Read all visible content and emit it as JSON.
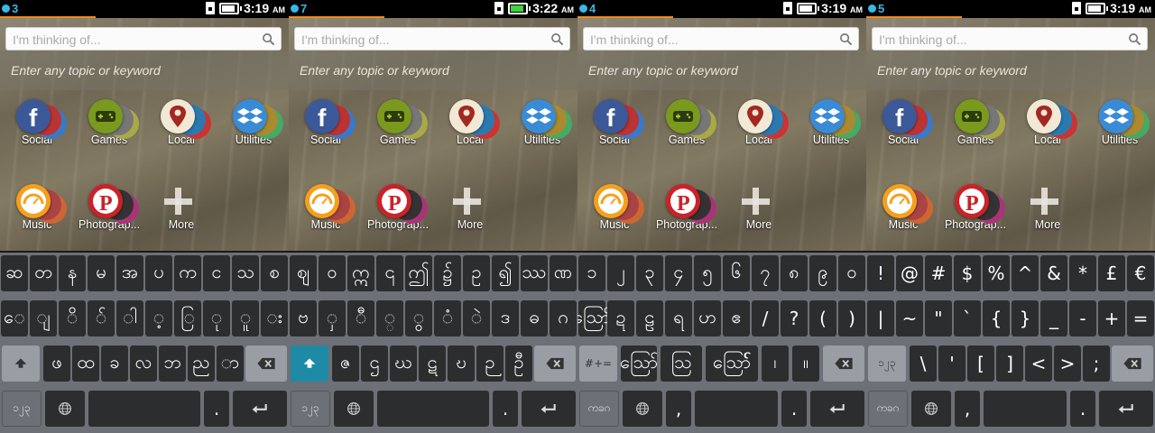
{
  "colors": {
    "accent_orange": "#f08a1e",
    "notif_blue": "#3ab7e8",
    "key_dark": "#2c2d2f",
    "key_fn": "#9a9ea4",
    "shift_active": "#1e8aa6",
    "keyboard_bg": "#6d7076",
    "battery_green": "#3fd13f"
  },
  "screens": [
    {
      "notif_count": "3",
      "progress_fraction": 0.33,
      "time": "3:19",
      "ampm": "AM",
      "charging": false,
      "search": {
        "placeholder": "I'm thinking of...",
        "hint": "Enter any topic or keyword"
      },
      "tiles": [
        "Social",
        "Games",
        "Local",
        "Utilities",
        "Music",
        "Photograp...",
        "More"
      ],
      "keys": {
        "row1": [
          "ဆ",
          "တ",
          "န",
          "မ",
          "အ",
          "ပ",
          "က",
          "င",
          "သ",
          "စ"
        ],
        "row2": [
          "ေ",
          "ျ",
          "ိ",
          "်",
          "ါ",
          "့",
          "ြ",
          "ု",
          "ူ",
          "း"
        ],
        "row3": [
          "shift-icon",
          "ဖ",
          "ထ",
          "ခ",
          "လ",
          "ဘ",
          "ည",
          "ာ",
          "backspace-icon"
        ],
        "row4": [
          "၁၂၃",
          "globe-icon",
          "space",
          ".",
          "enter-icon"
        ]
      },
      "shift_active": false
    },
    {
      "notif_count": "7",
      "progress_fraction": 0.33,
      "time": "3:22",
      "ampm": "AM",
      "charging": true,
      "search": {
        "placeholder": "I'm thinking of...",
        "hint": "Enter any topic or keyword"
      },
      "tiles": [
        "Social",
        "Games",
        "Local",
        "Utilities",
        "Music",
        "Photograp...",
        "More"
      ],
      "keys": {
        "row1": [
          "ဈ",
          "ဝ",
          "ဣ",
          "၎",
          "ဤ",
          "၌",
          "ဥ",
          "၍",
          "ဿ",
          "ဏ"
        ],
        "row2": [
          "ဗ",
          "ှ",
          "ီ",
          "္",
          "ွ",
          "ံ",
          "ဲ",
          "ဒ",
          "ဓ",
          "ဂ"
        ],
        "row3": [
          "shift-icon",
          "ဇ",
          "ဌ",
          "ဃ",
          "ဋ",
          "ဎ",
          "ဉ",
          "ဦ",
          "backspace-icon"
        ],
        "row4": [
          "၁၂၃",
          "globe-icon",
          "space",
          ".",
          "enter-icon"
        ]
      },
      "shift_active": true
    },
    {
      "notif_count": "4",
      "progress_fraction": 0.33,
      "time": "3:19",
      "ampm": "AM",
      "charging": false,
      "search": {
        "placeholder": "I'm thinking of...",
        "hint": "Enter any topic or keyword"
      },
      "tiles": [
        "Social",
        "Games",
        "Local",
        "Utilities",
        "Music",
        "Photograp...",
        "More"
      ],
      "keys": {
        "row1": [
          "၁",
          "၂",
          "၃",
          "၄",
          "၅",
          "၆",
          "၇",
          "၈",
          "၉",
          "၀"
        ],
        "row2": [
          "ဪ",
          "ဍ",
          "ဠ",
          "ရ",
          "ဟ",
          "ဧ",
          "/",
          "?",
          "(",
          ")"
        ],
        "row3": [
          "#+=",
          "ဪ",
          "ဩ",
          "ဪ်",
          "၊",
          "။",
          "backspace-icon"
        ],
        "row4": [
          "ကခဂ",
          "globe-icon",
          ",",
          "space",
          ".",
          "enter-icon"
        ]
      },
      "shift_active": false
    },
    {
      "notif_count": "5",
      "progress_fraction": 0.33,
      "time": "3:19",
      "ampm": "AM",
      "charging": false,
      "search": {
        "placeholder": "I'm thinking of...",
        "hint": "Enter any topic or keyword"
      },
      "tiles": [
        "Social",
        "Games",
        "Local",
        "Utilities",
        "Music",
        "Photograp...",
        "More"
      ],
      "keys": {
        "row1": [
          "!",
          "@",
          "#",
          "$",
          "%",
          "^",
          "&",
          "*",
          "£",
          "€"
        ],
        "row2": [
          "|",
          "~",
          "\"",
          "`",
          "{",
          "}",
          "_",
          "-",
          "+",
          "="
        ],
        "row3": [
          "၁၂၃",
          "\\",
          "'",
          "[",
          "]",
          "<",
          ">",
          ";",
          "backspace-icon"
        ],
        "row4": [
          "ကခဂ",
          "globe-icon",
          ",",
          "space",
          ".",
          "enter-icon"
        ]
      },
      "shift_active": false
    }
  ]
}
